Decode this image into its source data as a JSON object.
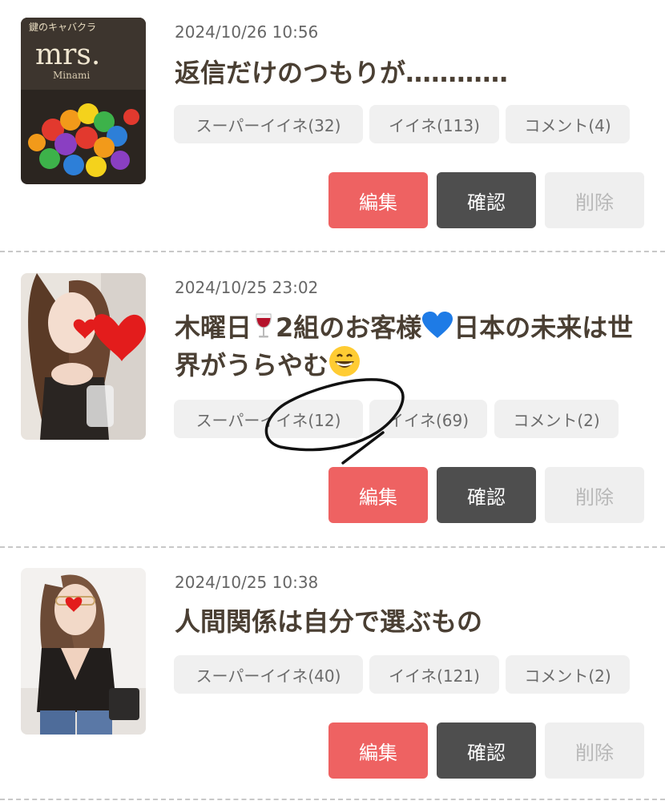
{
  "posts": [
    {
      "date": "2024/10/26 10:56",
      "title": "返信だけのつもりが…………",
      "super_like": "スーパーイイネ(32)",
      "like": "イイネ(113)",
      "comment": "コメント(4)",
      "thumb_text": {
        "top": "鍵のキャバクラ",
        "logo": "mrs.",
        "sub": "Minami"
      }
    },
    {
      "date": "2024/10/25 23:02",
      "title_parts": [
        "木曜日",
        "2組のお客様",
        "日本の未来は世界がうらやむ"
      ],
      "super_like": "スーパーイイネ(12)",
      "like": "イイネ(69)",
      "comment": "コメント(2)"
    },
    {
      "date": "2024/10/25 10:38",
      "title": "人間関係は自分で選ぶもの",
      "super_like": "スーパーイイネ(40)",
      "like": "イイネ(121)",
      "comment": "コメント(2)"
    }
  ],
  "buttons": {
    "edit": "編集",
    "confirm": "確認",
    "delete": "削除"
  },
  "icons": {
    "wine": "wine-glass-icon",
    "blue_heart": "blue-heart-icon",
    "grin": "grinning-face-icon"
  },
  "colors": {
    "edit": "#ee6262",
    "confirm": "#4e4e4e",
    "delete_bg": "#efefef",
    "title": "#4a3f33"
  }
}
